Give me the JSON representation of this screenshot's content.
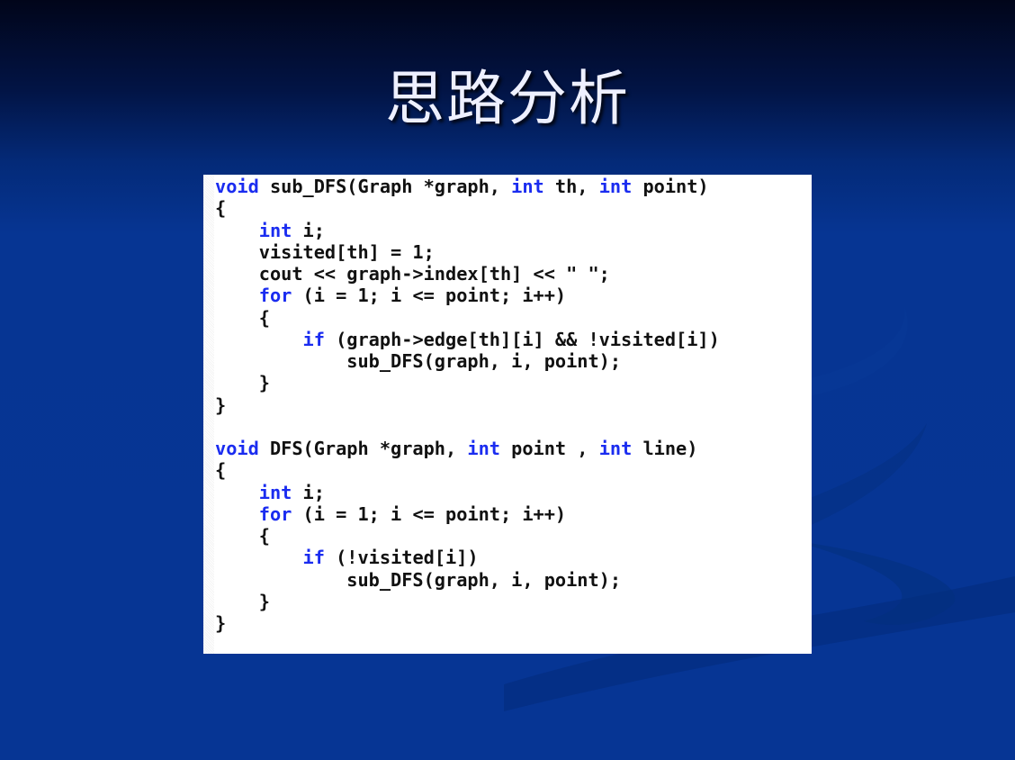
{
  "slide": {
    "title": "思路分析",
    "colors": {
      "background_top": "#01051a",
      "background_bottom": "#063594",
      "title_text": "#eef0ff",
      "code_background": "#ffffff",
      "code_text": "#111111",
      "code_keyword": "#1a2cf0"
    }
  },
  "code": {
    "language": "C++",
    "keywords": [
      "void",
      "int",
      "for",
      "if"
    ],
    "lines": [
      "void sub_DFS(Graph *graph, int th, int point)",
      "{",
      "    int i;",
      "    visited[th] = 1;",
      "    cout << graph->index[th] << \" \";",
      "    for (i = 1; i <= point; i++)",
      "    {",
      "        if (graph->edge[th][i] && !visited[i])",
      "            sub_DFS(graph, i, point);",
      "    }",
      "}",
      "",
      "void DFS(Graph *graph, int point , int line)",
      "{",
      "    int i;",
      "    for (i = 1; i <= point; i++)",
      "    {",
      "        if (!visited[i])",
      "            sub_DFS(graph, i, point);",
      "    }",
      "}"
    ]
  }
}
